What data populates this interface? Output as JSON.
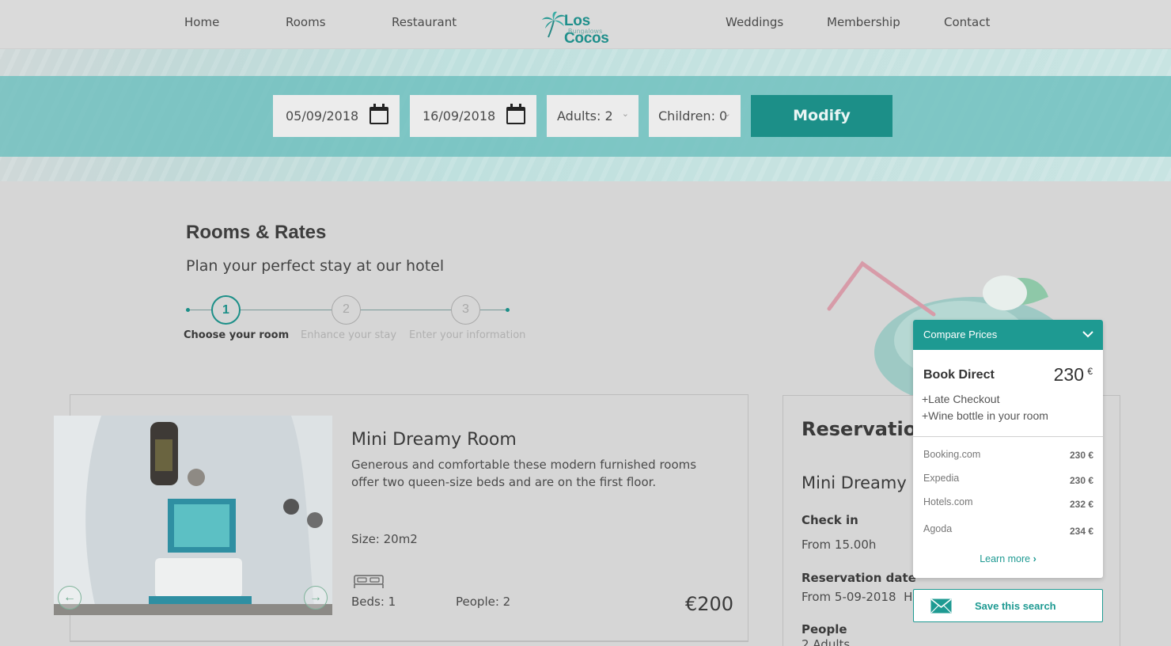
{
  "nav": {
    "home": "Home",
    "rooms": "Rooms",
    "restaurant": "Restaurant",
    "weddings": "Weddings",
    "membership": "Membership",
    "contact": "Contact",
    "logo_name": "Los Cocos",
    "logo_sub": "Bungalows"
  },
  "search": {
    "check_in": "05/09/2018",
    "check_out": "16/09/2018",
    "adults": "Adults: 2",
    "children": "Children: 0",
    "modify_label": "Modify"
  },
  "page": {
    "title": "Rooms & Rates",
    "subtitle": "Plan your perfect stay at our hotel"
  },
  "steps": [
    {
      "number": "1",
      "label": "Choose your room"
    },
    {
      "number": "2",
      "label": "Enhance your stay"
    },
    {
      "number": "3",
      "label": "Enter your information"
    }
  ],
  "room": {
    "title": "Mini Dreamy Room",
    "description": "Generous and comfortable these modern furnished rooms offer two queen-size beds and are on the first floor.",
    "size": "Size: 20m2",
    "beds": "Beds: 1",
    "people": "People: 2",
    "price": "€200"
  },
  "reservation": {
    "title": "Reservation",
    "room": "Mini Dreamy",
    "check_in_label": "Check in",
    "check_in_value": "From 15.00h",
    "date_label": "Reservation date",
    "date_value": "From 5-09-2018",
    "date_value_suffix": "Ha",
    "people_label": "People",
    "people_value": "2 Adults"
  },
  "compare": {
    "header": "Compare Prices",
    "direct_label": "Book Direct",
    "direct_price": "230",
    "currency": "€",
    "perks": [
      "+Late Checkout",
      "+Wine bottle in your room"
    ],
    "otas": [
      {
        "name": "Booking.com",
        "price": "230 €"
      },
      {
        "name": "Expedia",
        "price": "230 €"
      },
      {
        "name": "Hotels.com",
        "price": "232 €"
      },
      {
        "name": "Agoda",
        "price": "234 €"
      }
    ],
    "learn_more": "Learn more"
  },
  "save_search": "Save this search",
  "colors": {
    "brand_teal": "#1e9a92",
    "modify_button": "#1c8f88",
    "overlay_gray": "#d6d6d6"
  }
}
